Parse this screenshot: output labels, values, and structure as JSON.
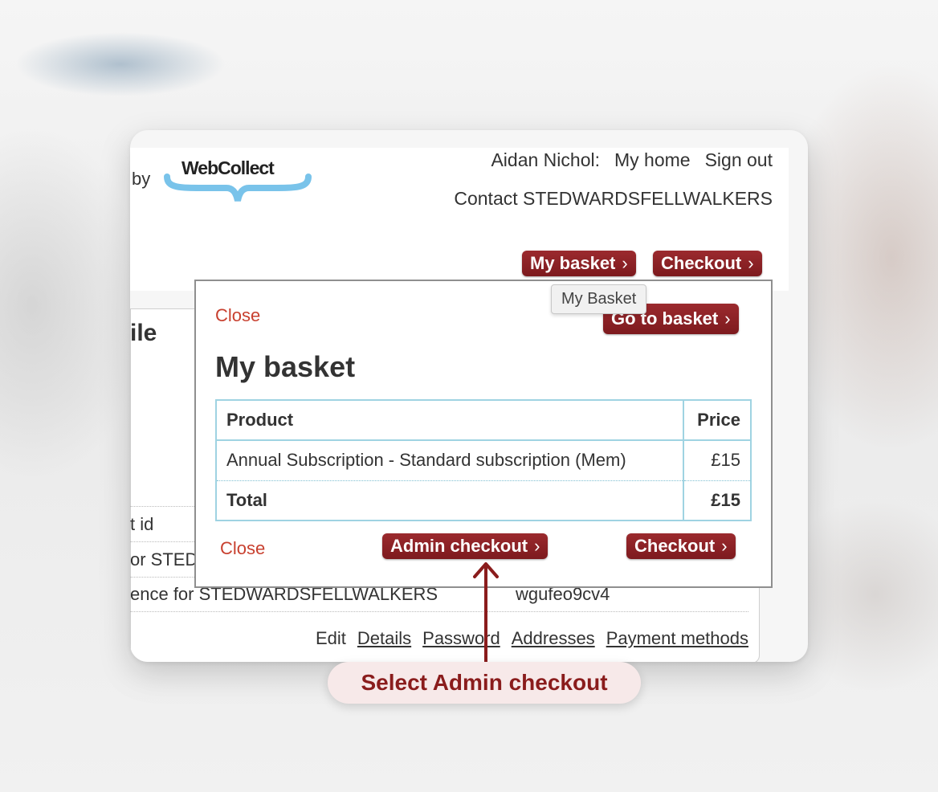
{
  "header": {
    "powered_by_suffix": "by",
    "logo_text": "WebCollect",
    "user_name": "Aidan Nichol:",
    "my_home": "My home",
    "sign_out": "Sign out",
    "contact": "Contact STEDWARDSFELLWALKERS",
    "my_basket_button": "My basket",
    "checkout_button": "Checkout"
  },
  "page": {
    "heading_fragment": "ile",
    "rows": [
      {
        "label": "t id",
        "value": ""
      },
      {
        "label": "or STED",
        "value": ""
      },
      {
        "label": "ence for STEDWARDSFELLWALKERS",
        "value": "wgufeo9cv4"
      }
    ],
    "edit_label": "Edit",
    "edit_links": [
      "Details",
      "Password",
      "Addresses",
      "Payment methods"
    ]
  },
  "modal": {
    "close_label": "Close",
    "tooltip": "My Basket",
    "go_to_basket": "Go to basket",
    "title": "My basket",
    "table": {
      "headers": [
        "Product",
        "Price"
      ],
      "items": [
        {
          "product": "Annual Subscription - Standard subscription (Mem)",
          "price": "£15"
        }
      ],
      "total_label": "Total",
      "total_value": "£15"
    },
    "admin_checkout": "Admin checkout",
    "checkout": "Checkout"
  },
  "annotation": {
    "text": "Select Admin checkout",
    "color": "#8a1c1c"
  },
  "colors": {
    "button_red": "#8b2226",
    "link_red": "#c8402f",
    "table_border": "#9fd3e2"
  }
}
